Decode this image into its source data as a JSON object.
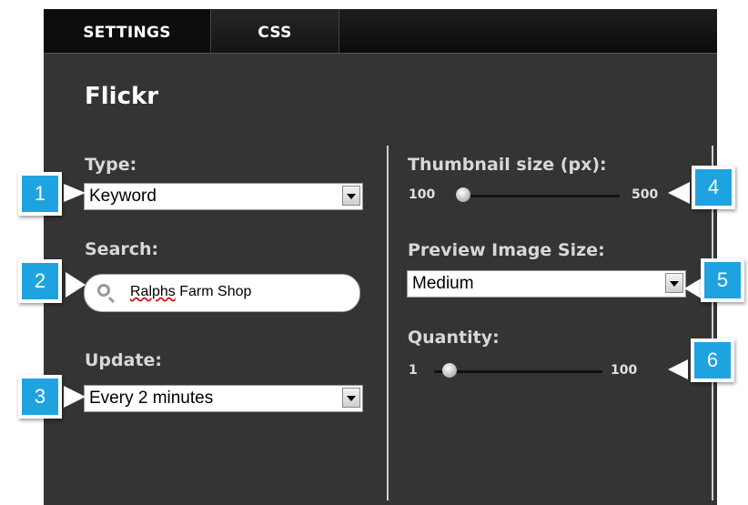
{
  "tabs": [
    "SETTINGS",
    "CSS"
  ],
  "title": "Flickr",
  "left": {
    "type_label": "Type:",
    "type_value": "Keyword",
    "search_label": "Search:",
    "search_value_prefix": "Ralphs",
    "search_value_rest": " Farm Shop",
    "update_label": "Update:",
    "update_value": "Every 2 minutes"
  },
  "right": {
    "thumb_label": "Thumbnail size (px):",
    "thumb_min": "100",
    "thumb_max": "500",
    "thumb_value_fraction": 0.0,
    "preview_label": "Preview Image Size:",
    "preview_value": "Medium",
    "qty_label": "Quantity:",
    "qty_min": "1",
    "qty_max": "100",
    "qty_value_fraction": 0.05
  },
  "callouts": [
    "1",
    "2",
    "3",
    "4",
    "5",
    "6"
  ],
  "colors": {
    "panel": "#343434",
    "callout": "#1fa3e0"
  }
}
